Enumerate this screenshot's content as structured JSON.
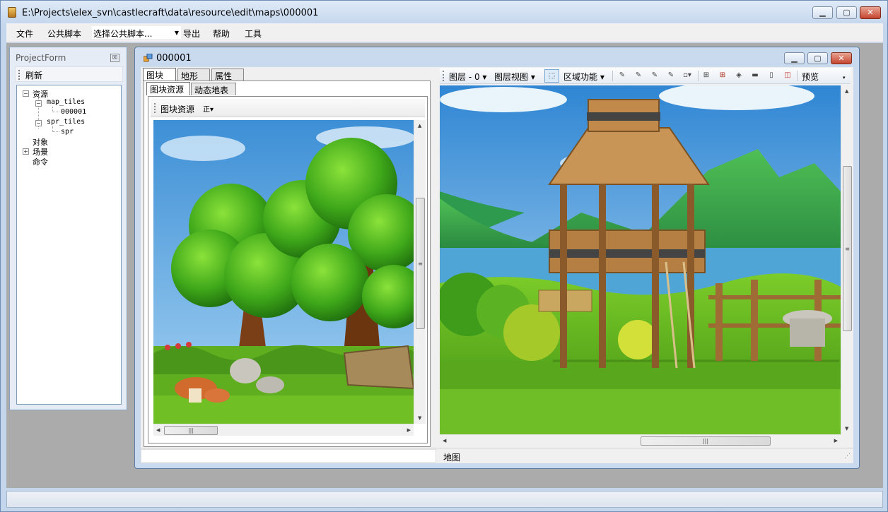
{
  "window": {
    "title": "E:\\Projects\\elex_svn\\castlecraft\\data\\resource\\edit\\maps\\000001"
  },
  "menu": {
    "file": "文件",
    "public_script": "公共脚本",
    "script_select": "选择公共脚本...",
    "export": "导出",
    "help": "帮助",
    "tools": "工具"
  },
  "project_form": {
    "title": "ProjectForm",
    "close_glyph": "☒",
    "refresh": "刷新",
    "tree": {
      "resources": "资源",
      "map_tiles": "map_tiles",
      "map_tile_item": "000001",
      "spr_tiles": "spr_tiles",
      "spr_item": "spr",
      "objects": "对象",
      "scenes": "场景",
      "commands": "命令"
    }
  },
  "child": {
    "title": "000001",
    "tabs": {
      "tile": "图块",
      "terrain": "地形",
      "property": "属性"
    },
    "subtabs": {
      "tile_resource": "图块资源",
      "dynamic_tiles": "动态地表"
    },
    "tile_toolbar": {
      "label": "图块资源",
      "mode": "正"
    },
    "map_toolbar": {
      "layer": "图层 - 0",
      "layer_view": "图层视图",
      "region_func": "区域功能",
      "preview": "预览"
    },
    "status": {
      "map_label": "地图"
    }
  },
  "colors": {
    "accent": "#3c7fb1",
    "close": "#c5452f"
  }
}
